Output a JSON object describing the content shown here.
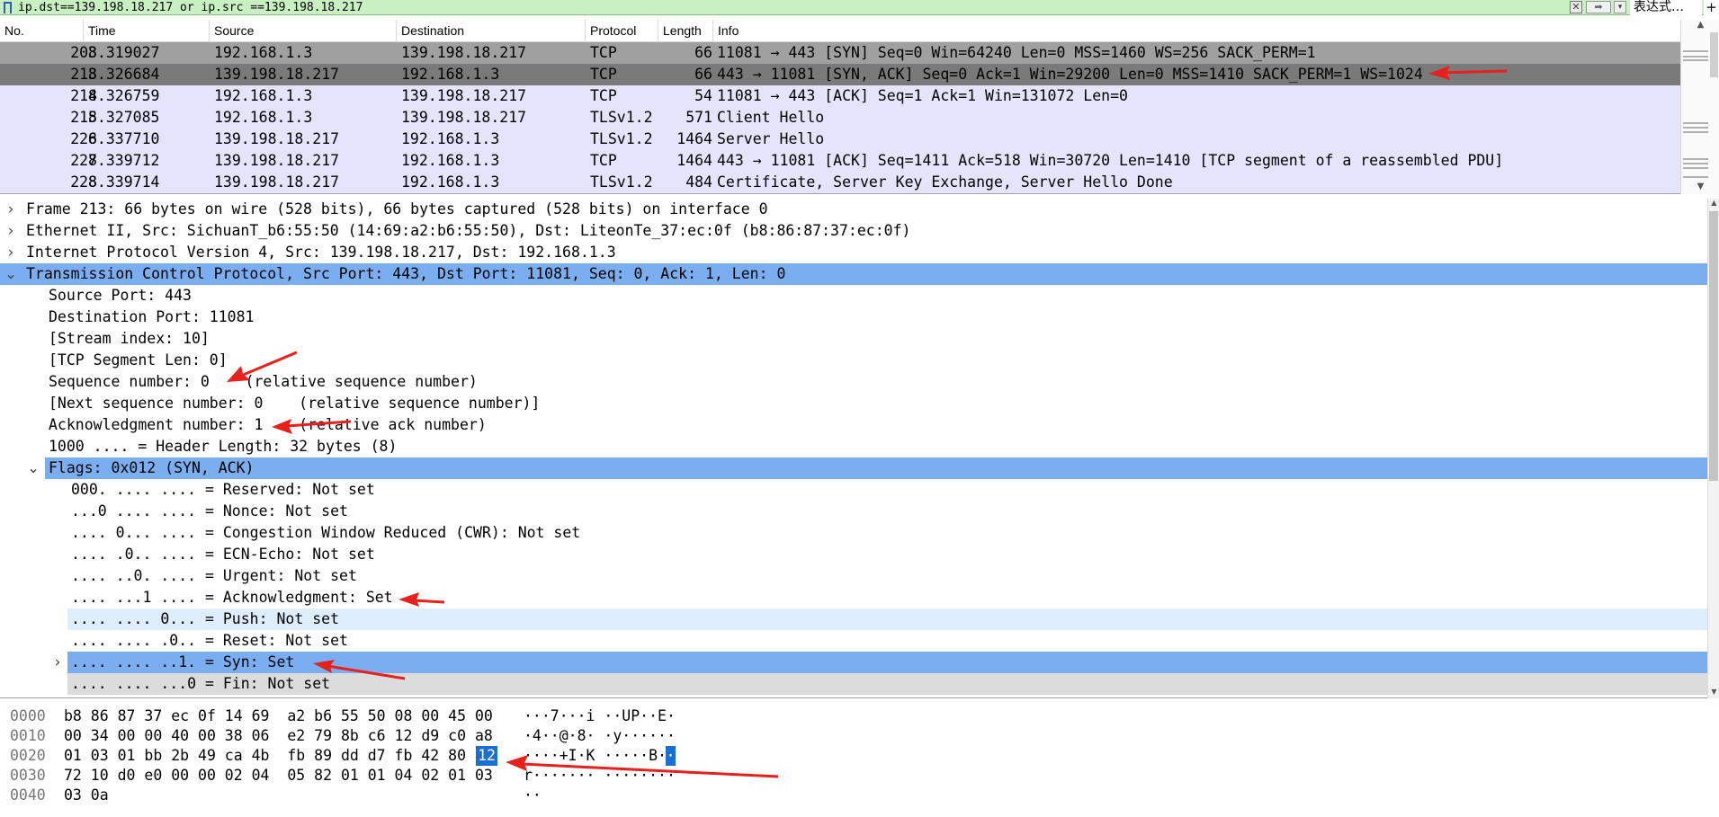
{
  "filter": {
    "expression": "ip.dst==139.198.18.217 or ip.src ==139.198.18.217",
    "clear_icon": "clear-icon",
    "apply_icon": "arrow-right-icon",
    "expression_button": "表达式…",
    "add_button": "+"
  },
  "packet_list": {
    "headers": [
      "No.",
      "Time",
      "Source",
      "Destination",
      "Protocol",
      "Length",
      "Info"
    ],
    "rows": [
      {
        "no": "203",
        "time": "8.319027",
        "src": "192.168.1.3",
        "dst": "139.198.18.217",
        "proto": "TCP",
        "len": "66",
        "info": "11081 → 443 [SYN] Seq=0 Win=64240 Len=0 MSS=1460 WS=256 SACK_PERM=1"
      },
      {
        "no": "213",
        "time": "8.326684",
        "src": "139.198.18.217",
        "dst": "192.168.1.3",
        "proto": "TCP",
        "len": "66",
        "info": "443 → 11081 [SYN, ACK] Seq=0 Ack=1 Win=29200 Len=0 MSS=1410 SACK_PERM=1 WS=1024"
      },
      {
        "no": "214",
        "time": "8.326759",
        "src": "192.168.1.3",
        "dst": "139.198.18.217",
        "proto": "TCP",
        "len": "54",
        "info": "11081 → 443 [ACK] Seq=1 Ack=1 Win=131072 Len=0"
      },
      {
        "no": "215",
        "time": "8.327085",
        "src": "192.168.1.3",
        "dst": "139.198.18.217",
        "proto": "TLSv1.2",
        "len": "571",
        "info": "Client Hello"
      },
      {
        "no": "226",
        "time": "8.337710",
        "src": "139.198.18.217",
        "dst": "192.168.1.3",
        "proto": "TLSv1.2",
        "len": "1464",
        "info": "Server Hello"
      },
      {
        "no": "227",
        "time": "8.339712",
        "src": "139.198.18.217",
        "dst": "192.168.1.3",
        "proto": "TCP",
        "len": "1464",
        "info": "443 → 11081 [ACK] Seq=1411 Ack=518 Win=30720 Len=1410 [TCP segment of a reassembled PDU]"
      },
      {
        "no": "228",
        "time": "8.339714",
        "src": "139.198.18.217",
        "dst": "192.168.1.3",
        "proto": "TLSv1.2",
        "len": "484",
        "info": "Certificate, Server Key Exchange, Server Hello Done"
      }
    ]
  },
  "detail": {
    "frame": "Frame 213: 66 bytes on wire (528 bits), 66 bytes captured (528 bits) on interface 0",
    "ethernet": "Ethernet II, Src: SichuanT_b6:55:50 (14:69:a2:b6:55:50), Dst: LiteonTe_37:ec:0f (b8:86:87:37:ec:0f)",
    "ip": "Internet Protocol Version 4, Src: 139.198.18.217, Dst: 192.168.1.3",
    "tcp": "Transmission Control Protocol, Src Port: 443, Dst Port: 11081, Seq: 0, Ack: 1, Len: 0",
    "tcp_fields": [
      "Source Port: 443",
      "Destination Port: 11081",
      "[Stream index: 10]",
      "[TCP Segment Len: 0]",
      "Sequence number: 0    (relative sequence number)",
      "[Next sequence number: 0    (relative sequence number)]",
      "Acknowledgment number: 1    (relative ack number)",
      "1000 .... = Header Length: 32 bytes (8)"
    ],
    "flags": "Flags: 0x012 (SYN, ACK)",
    "flag_fields": [
      "000. .... .... = Reserved: Not set",
      "...0 .... .... = Nonce: Not set",
      ".... 0... .... = Congestion Window Reduced (CWR): Not set",
      ".... .0.. .... = ECN-Echo: Not set",
      ".... ..0. .... = Urgent: Not set",
      ".... ...1 .... = Acknowledgment: Set",
      ".... .... 0... = Push: Not set",
      ".... .... .0.. = Reset: Not set",
      ".... .... ..1. = Syn: Set",
      ".... .... ...0 = Fin: Not set"
    ]
  },
  "hex": {
    "rows": [
      {
        "offset": "0000",
        "bytes": "b8 86 87 37 ec 0f 14 69  a2 b6 55 50 08 00 45 00",
        "ascii": "···7···i ··UP··E·"
      },
      {
        "offset": "0010",
        "bytes": "00 34 00 00 40 00 38 06  e2 79 8b c6 12 d9 c0 a8",
        "ascii": "·4··@·8· ·y······"
      },
      {
        "offset": "0020",
        "bytes": "01 03 01 bb 2b 49 ca 4b  fb 89 dd d7 fb 42 80   ",
        "ascii": "····+I·K ·····B· "
      },
      {
        "offset": "0030",
        "bytes": "72 10 d0 e0 00 00 02 04  05 82 01 01 04 02 01 03",
        "ascii": "r······· ········"
      },
      {
        "offset": "0040",
        "bytes": "03 0a",
        "ascii": "··"
      }
    ],
    "selected_byte": "12",
    "selected_ascii": "·"
  },
  "colors": {
    "filter_bg": "#c8f0c0",
    "row_tcp_handshake": "#a0a0a0",
    "row_selected": "#7a7a7a",
    "row_default": "#e4e4fc",
    "tree_selected": "#7aaef0",
    "annotation_arrow": "#e8201c"
  }
}
